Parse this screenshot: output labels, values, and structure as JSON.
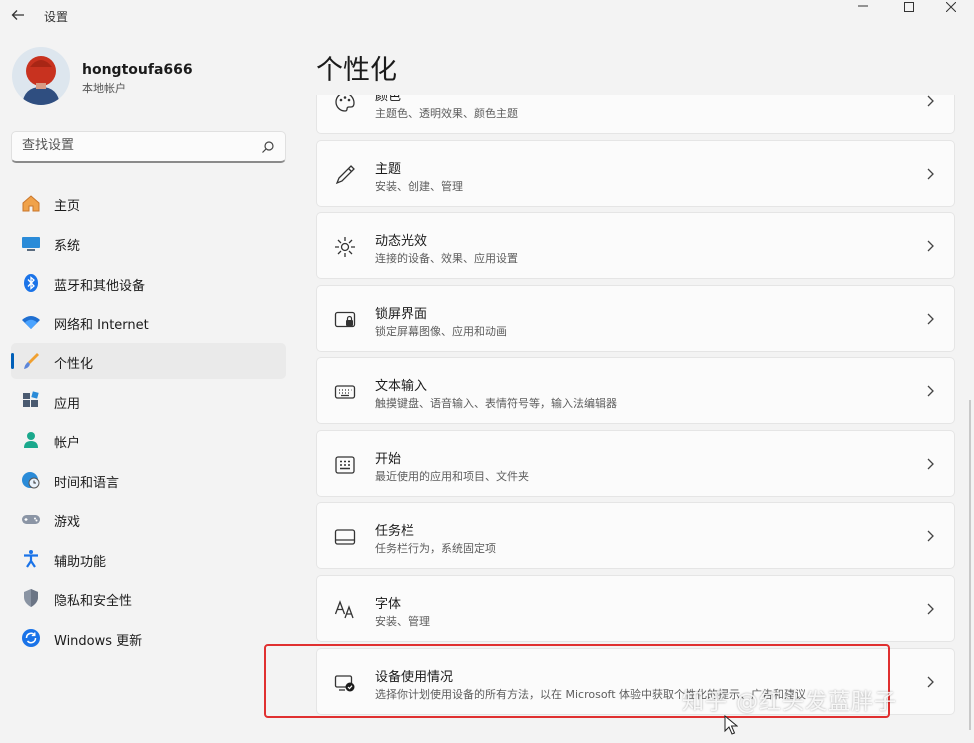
{
  "window": {
    "title": "设置",
    "back_icon": "back-arrow-icon",
    "controls": [
      "minimize-icon",
      "maximize-icon",
      "close-icon"
    ]
  },
  "user": {
    "name": "hongtoufa666",
    "account_type": "本地帐户"
  },
  "search": {
    "placeholder": "查找设置",
    "icon": "search-icon"
  },
  "nav": {
    "items": [
      {
        "label": "主页",
        "icon": "home-icon",
        "active": false
      },
      {
        "label": "系统",
        "icon": "monitor-icon",
        "active": false
      },
      {
        "label": "蓝牙和其他设备",
        "icon": "bluetooth-icon",
        "active": false
      },
      {
        "label": "网络和 Internet",
        "icon": "wifi-icon",
        "active": false
      },
      {
        "label": "个性化",
        "icon": "brush-icon",
        "active": true
      },
      {
        "label": "应用",
        "icon": "apps-icon",
        "active": false
      },
      {
        "label": "帐户",
        "icon": "person-icon",
        "active": false
      },
      {
        "label": "时间和语言",
        "icon": "globe-clock-icon",
        "active": false
      },
      {
        "label": "游戏",
        "icon": "gamepad-icon",
        "active": false
      },
      {
        "label": "辅助功能",
        "icon": "accessibility-icon",
        "active": false
      },
      {
        "label": "隐私和安全性",
        "icon": "shield-icon",
        "active": false
      },
      {
        "label": "Windows 更新",
        "icon": "update-icon",
        "active": false
      }
    ]
  },
  "page": {
    "title": "个性化"
  },
  "cards": [
    {
      "title": "颜色",
      "desc": "主题色、透明效果、颜色主题",
      "icon": "palette-icon"
    },
    {
      "title": "主题",
      "desc": "安装、创建、管理",
      "icon": "pen-icon"
    },
    {
      "title": "动态光效",
      "desc": "连接的设备、效果、应用设置",
      "icon": "light-burst-icon"
    },
    {
      "title": "锁屏界面",
      "desc": "锁定屏幕图像、应用和动画",
      "icon": "lock-screen-icon"
    },
    {
      "title": "文本输入",
      "desc": "触摸键盘、语音输入、表情符号等，输入法编辑器",
      "icon": "keyboard-icon"
    },
    {
      "title": "开始",
      "desc": "最近使用的应用和项目、文件夹",
      "icon": "start-grid-icon"
    },
    {
      "title": "任务栏",
      "desc": "任务栏行为，系统固定项",
      "icon": "taskbar-icon"
    },
    {
      "title": "字体",
      "desc": "安装、管理",
      "icon": "font-icon"
    },
    {
      "title": "设备使用情况",
      "desc": "选择你计划使用设备的所有方法，以在 Microsoft 体验中获取个性化的提示、广告和建议",
      "icon": "device-usage-icon"
    }
  ],
  "watermark": "知乎 @红头发蓝胖子",
  "colors": {
    "accent": "#005fb8",
    "highlight_border": "#e03030"
  }
}
